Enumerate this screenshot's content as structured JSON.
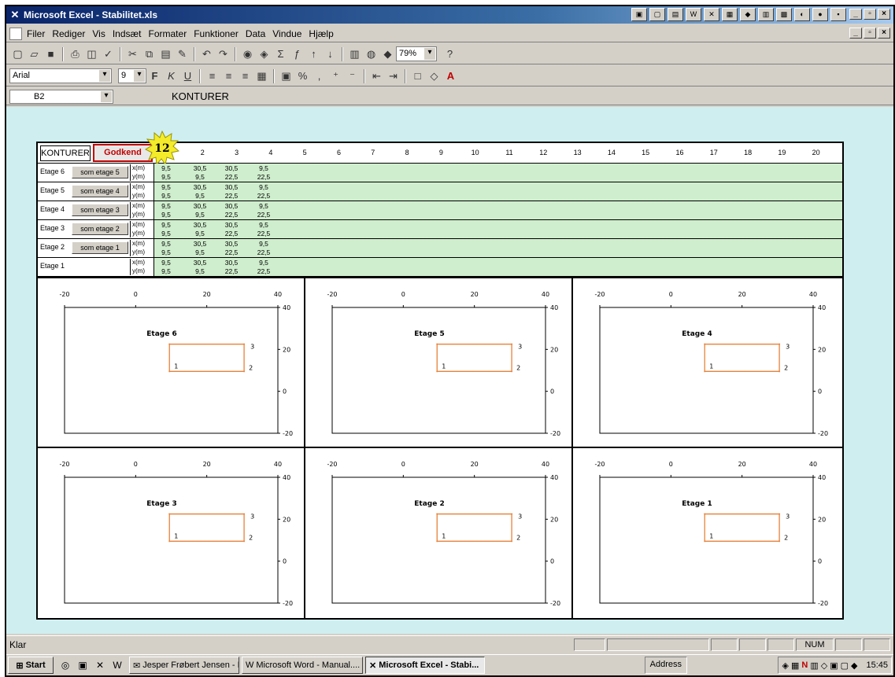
{
  "app": {
    "title": "Microsoft Excel - Stabilitet.xls"
  },
  "menu": [
    "Filer",
    "Rediger",
    "Vis",
    "Indsæt",
    "Formater",
    "Funktioner",
    "Data",
    "Vindue",
    "Hjælp"
  ],
  "toolbar": {
    "zoom": "79%",
    "font": "Arial",
    "font_size": "9"
  },
  "formula_bar": {
    "cell_ref": "B2",
    "content": "KONTURER"
  },
  "sheet": {
    "konturer_label": "KONTURER",
    "godkend_label": "Godkend",
    "step_badge": "12",
    "columns": [
      "1",
      "2",
      "3",
      "4",
      "5",
      "6",
      "7",
      "8",
      "9",
      "10",
      "11",
      "12",
      "13",
      "14",
      "15",
      "16",
      "17",
      "18",
      "19",
      "20"
    ],
    "rows": [
      {
        "etage": "Etage 6",
        "button": "som etage 5",
        "x": [
          "9,5",
          "30,5",
          "30,5",
          "9,5"
        ],
        "y": [
          "9,5",
          "9,5",
          "22,5",
          "22,5"
        ]
      },
      {
        "etage": "Etage 5",
        "button": "som etage 4",
        "x": [
          "9,5",
          "30,5",
          "30,5",
          "9,5"
        ],
        "y": [
          "9,5",
          "9,5",
          "22,5",
          "22,5"
        ]
      },
      {
        "etage": "Etage 4",
        "button": "som etage 3",
        "x": [
          "9,5",
          "30,5",
          "30,5",
          "9,5"
        ],
        "y": [
          "9,5",
          "9,5",
          "22,5",
          "22,5"
        ]
      },
      {
        "etage": "Etage 3",
        "button": "som etage 2",
        "x": [
          "9,5",
          "30,5",
          "30,5",
          "9,5"
        ],
        "y": [
          "9,5",
          "9,5",
          "22,5",
          "22,5"
        ]
      },
      {
        "etage": "Etage 2",
        "button": "som etage 1",
        "x": [
          "9,5",
          "30,5",
          "30,5",
          "9,5"
        ],
        "y": [
          "9,5",
          "9,5",
          "22,5",
          "22,5"
        ]
      },
      {
        "etage": "Etage 1",
        "button": "",
        "x": [
          "9,5",
          "30,5",
          "30,5",
          "9,5"
        ],
        "y": [
          "9,5",
          "9,5",
          "22,5",
          "22,5"
        ]
      }
    ],
    "x_label": "x(m)",
    "y_label": "y(m)"
  },
  "chart_data": [
    {
      "type": "scatter",
      "title": "Etage 6",
      "x": [
        9.5,
        30.5,
        30.5,
        9.5
      ],
      "y": [
        9.5,
        9.5,
        22.5,
        22.5
      ],
      "point_labels": [
        "1",
        "2",
        "3"
      ],
      "xlim": [
        -20,
        40
      ],
      "ylim": [
        -20,
        40
      ],
      "xticks": [
        "-20",
        "0",
        "20",
        "40"
      ],
      "yticks": [
        "40",
        "20",
        "0",
        "-20"
      ],
      "color": "#e8823a"
    },
    {
      "type": "scatter",
      "title": "Etage 5",
      "x": [
        9.5,
        30.5,
        30.5,
        9.5
      ],
      "y": [
        9.5,
        9.5,
        22.5,
        22.5
      ],
      "point_labels": [
        "1",
        "2",
        "3"
      ],
      "xlim": [
        -20,
        40
      ],
      "ylim": [
        -20,
        40
      ],
      "xticks": [
        "-20",
        "0",
        "20",
        "40"
      ],
      "yticks": [
        "40",
        "20",
        "0",
        "-20"
      ],
      "color": "#e8823a"
    },
    {
      "type": "scatter",
      "title": "Etage 4",
      "x": [
        9.5,
        30.5,
        30.5,
        9.5
      ],
      "y": [
        9.5,
        9.5,
        22.5,
        22.5
      ],
      "point_labels": [
        "1",
        "2",
        "3"
      ],
      "xlim": [
        -20,
        40
      ],
      "ylim": [
        -20,
        40
      ],
      "xticks": [
        "-20",
        "0",
        "20",
        "40"
      ],
      "yticks": [
        "40",
        "20",
        "0",
        "-20"
      ],
      "color": "#e8823a"
    },
    {
      "type": "scatter",
      "title": "Etage 3",
      "x": [
        9.5,
        30.5,
        30.5,
        9.5
      ],
      "y": [
        9.5,
        9.5,
        22.5,
        22.5
      ],
      "point_labels": [
        "1",
        "2",
        "3"
      ],
      "xlim": [
        -20,
        40
      ],
      "ylim": [
        -20,
        40
      ],
      "xticks": [
        "-20",
        "0",
        "20",
        "40"
      ],
      "yticks": [
        "40",
        "20",
        "0",
        "-20"
      ],
      "color": "#e8823a"
    },
    {
      "type": "scatter",
      "title": "Etage 2",
      "x": [
        9.5,
        30.5,
        30.5,
        9.5
      ],
      "y": [
        9.5,
        9.5,
        22.5,
        22.5
      ],
      "point_labels": [
        "1",
        "2",
        "3"
      ],
      "xlim": [
        -20,
        40
      ],
      "ylim": [
        -20,
        40
      ],
      "xticks": [
        "-20",
        "0",
        "20",
        "40"
      ],
      "yticks": [
        "40",
        "20",
        "0",
        "-20"
      ],
      "color": "#e8823a"
    },
    {
      "type": "scatter",
      "title": "Etage 1",
      "x": [
        9.5,
        30.5,
        30.5,
        9.5
      ],
      "y": [
        9.5,
        9.5,
        22.5,
        22.5
      ],
      "point_labels": [
        "1",
        "2",
        "3"
      ],
      "xlim": [
        -20,
        40
      ],
      "ylim": [
        -20,
        40
      ],
      "xticks": [
        "-20",
        "0",
        "20",
        "40"
      ],
      "yticks": [
        "40",
        "20",
        "0",
        "-20"
      ],
      "color": "#e8823a"
    }
  ],
  "status": {
    "text": "Klar",
    "num": "NUM"
  },
  "taskbar": {
    "start": "Start",
    "tasks": [
      "Jesper Frøbert Jensen - I...",
      "Microsoft Word - Manual....",
      "Microsoft Excel - Stabi..."
    ],
    "address": "Address",
    "clock": "15:45"
  }
}
